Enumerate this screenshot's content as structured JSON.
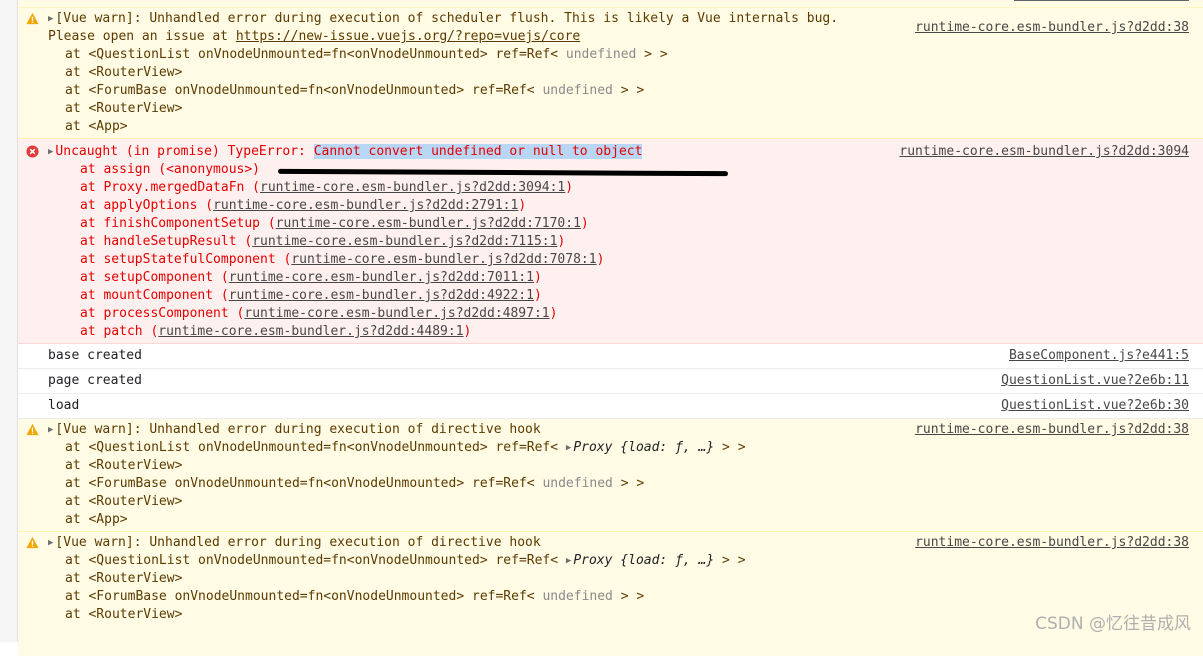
{
  "messages": [
    {
      "type": "warn",
      "summary": "[Vue warn]: Unhandled error during execution of scheduler flush. This is likely a Vue internals bug.",
      "line2_prefix": "Please open an issue at ",
      "line2_link": "https://new-issue.vuejs.org/?repo=vuejs/core",
      "source": "runtime-core.esm-bundler.js?d2dd:38",
      "trace": [
        {
          "text": "at <QuestionList onVnodeUnmounted=fn<onVnodeUnmounted> ref=Ref< ",
          "dim": "undefined",
          "end": " > >"
        },
        {
          "text": "at <RouterView>"
        },
        {
          "text": "at <ForumBase onVnodeUnmounted=fn<onVnodeUnmounted> ref=Ref< ",
          "dim": "undefined",
          "end": " > >"
        },
        {
          "text": "at <RouterView>"
        },
        {
          "text": "at <App>"
        }
      ]
    },
    {
      "type": "error",
      "summary_prefix": "Uncaught (in promise) TypeError: ",
      "summary_highlight": "Cannot convert undefined or null to object",
      "source": "runtime-core.esm-bundler.js?d2dd:3094",
      "first_frame": "at assign (<anonymous>)",
      "frames": [
        {
          "fn": "at Proxy.mergedDataFn (",
          "link": "runtime-core.esm-bundler.js?d2dd:3094:1"
        },
        {
          "fn": "at applyOptions (",
          "link": "runtime-core.esm-bundler.js?d2dd:2791:1"
        },
        {
          "fn": "at finishComponentSetup (",
          "link": "runtime-core.esm-bundler.js?d2dd:7170:1"
        },
        {
          "fn": "at handleSetupResult (",
          "link": "runtime-core.esm-bundler.js?d2dd:7115:1"
        },
        {
          "fn": "at setupStatefulComponent (",
          "link": "runtime-core.esm-bundler.js?d2dd:7078:1"
        },
        {
          "fn": "at setupComponent (",
          "link": "runtime-core.esm-bundler.js?d2dd:7011:1"
        },
        {
          "fn": "at mountComponent (",
          "link": "runtime-core.esm-bundler.js?d2dd:4922:1"
        },
        {
          "fn": "at processComponent (",
          "link": "runtime-core.esm-bundler.js?d2dd:4897:1"
        },
        {
          "fn": "at patch (",
          "link": "runtime-core.esm-bundler.js?d2dd:4489:1"
        }
      ],
      "close_paren": ")"
    },
    {
      "type": "log",
      "text": "base created",
      "source": "BaseComponent.js?e441:5"
    },
    {
      "type": "log",
      "text": "page created",
      "source": "QuestionList.vue?2e6b:11"
    },
    {
      "type": "log",
      "text": "load",
      "source": "QuestionList.vue?2e6b:30"
    },
    {
      "type": "warn",
      "summary": "[Vue warn]: Unhandled error during execution of directive hook",
      "source": "runtime-core.esm-bundler.js?d2dd:38",
      "trace": [
        {
          "text": "at <QuestionList onVnodeUnmounted=fn<onVnodeUnmounted> ref=Ref< ",
          "proxy": "Proxy {load: ƒ, …}",
          "end": " > >"
        },
        {
          "text": "at <RouterView>"
        },
        {
          "text": "at <ForumBase onVnodeUnmounted=fn<onVnodeUnmounted> ref=Ref< ",
          "dim": "undefined",
          "end": " > >"
        },
        {
          "text": "at <RouterView>"
        },
        {
          "text": "at <App>"
        }
      ]
    },
    {
      "type": "warn",
      "summary": "[Vue warn]: Unhandled error during execution of directive hook",
      "source": "runtime-core.esm-bundler.js?d2dd:38",
      "trace": [
        {
          "text": "at <QuestionList onVnodeUnmounted=fn<onVnodeUnmounted> ref=Ref< ",
          "proxy": "Proxy {load: ƒ, …}",
          "end": " > >"
        },
        {
          "text": "at <RouterView>"
        },
        {
          "text": "at <ForumBase onVnodeUnmounted=fn<onVnodeUnmounted> ref=Ref< ",
          "dim": "undefined",
          "end": " > >"
        },
        {
          "text": "at <RouterView>"
        }
      ]
    }
  ],
  "icons": {
    "warn": "warning-triangle-icon",
    "error": "error-circle-icon",
    "expand": "expand-triangle-icon"
  },
  "colors": {
    "warn_bg": "#fffbe5",
    "error_bg": "#fff0f0",
    "error_text": "#e50000",
    "highlight": "#b9d6f5"
  },
  "watermark": "CSDN @忆往昔成风"
}
